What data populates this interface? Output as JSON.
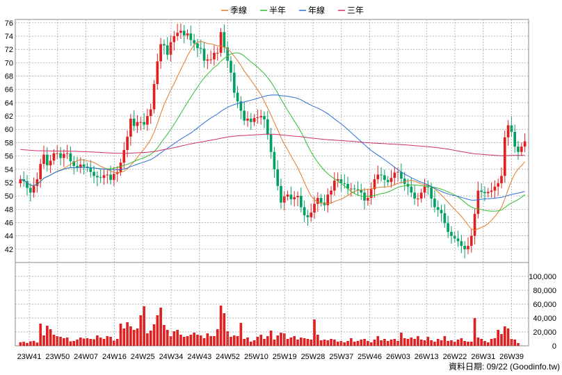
{
  "legend": [
    {
      "label": "季線",
      "color": "#e07b2a"
    },
    {
      "label": "半年",
      "color": "#2fbf2f"
    },
    {
      "label": "年線",
      "color": "#2d6fd6"
    },
    {
      "label": "三年",
      "color": "#d0306a"
    }
  ],
  "footer_note": "資料日期: 09/22 (Goodinfo.tw)",
  "colors": {
    "up": "#e02020",
    "down": "#00a060",
    "volume": "#e02020",
    "grid": "#999999"
  },
  "chart_data": [
    {
      "type": "candlestick",
      "title": "",
      "ylim": [
        40,
        76.5
      ],
      "y_ticks": [
        42,
        44,
        46,
        48,
        50,
        52,
        54,
        56,
        58,
        60,
        62,
        64,
        66,
        68,
        70,
        72,
        74,
        76
      ],
      "x_ticks": [
        "23W41",
        "23W50",
        "24W07",
        "24W16",
        "24W25",
        "24W34",
        "24W43",
        "24W52",
        "25W10",
        "25W19",
        "25W28",
        "25W37",
        "25W46",
        "26W03",
        "26W13",
        "26W22",
        "26W31",
        "26W39"
      ],
      "close": [
        52.5,
        52.2,
        51.2,
        50.5,
        51.5,
        52.5,
        54.8,
        56.2,
        54.6,
        55.3,
        56.4,
        56.4,
        55.7,
        56.3,
        56.4,
        55.2,
        54.5,
        54.3,
        54.7,
        54.4,
        54.2,
        53.6,
        53.0,
        52.8,
        52.7,
        53.1,
        53.2,
        52.4,
        53.3,
        53.6,
        55.0,
        56.9,
        58.9,
        61.6,
        60.5,
        61.1,
        61.1,
        60.7,
        62.0,
        63.0,
        66.8,
        70.2,
        72.8,
        72.6,
        71.2,
        73.1,
        74.0,
        74.5,
        74.8,
        74.1,
        74.4,
        73.4,
        72.9,
        72.2,
        72.1,
        70.3,
        70.5,
        70.5,
        71.5,
        71.5,
        74.6,
        72.3,
        70.3,
        68.5,
        65.5,
        64.2,
        62.8,
        61.3,
        61.6,
        61.1,
        61.7,
        61.8,
        62.0,
        61.5,
        59.2,
        56.6,
        54.0,
        51.5,
        49.0,
        49.9,
        50.2,
        49.5,
        49.8,
        50.0,
        48.3,
        47.1,
        46.8,
        47.5,
        48.8,
        49.7,
        49.0,
        48.6,
        50.2,
        50.8,
        52.3,
        52.5,
        51.9,
        51.8,
        51.1,
        51.1,
        51.0,
        50.9,
        50.5,
        49.3,
        49.7,
        51.0,
        52.5,
        53.2,
        53.1,
        52.4,
        52.1,
        52.7,
        53.5,
        53.6,
        52.6,
        51.8,
        51.4,
        50.5,
        49.6,
        49.6,
        50.5,
        51.4,
        51.3,
        49.6,
        48.3,
        47.9,
        47.4,
        45.9,
        44.6,
        44.0,
        43.6,
        43.2,
        42.5,
        42.0,
        42.5,
        44.0,
        47.3,
        50.8,
        50.6,
        50.4,
        50.6,
        50.8,
        51.4,
        51.9,
        53.0,
        58.8,
        60.6,
        59.6,
        57.4,
        56.6,
        57.4,
        58.2
      ],
      "volume": [
        5200,
        5800,
        4200,
        6500,
        7200,
        4800,
        32000,
        15000,
        29000,
        24000,
        16000,
        14000,
        13000,
        11000,
        12000,
        6500,
        7000,
        9000,
        12000,
        10500,
        11000,
        10000,
        9500,
        15000,
        12000,
        10000,
        14000,
        13000,
        7500,
        10000,
        32000,
        25000,
        34000,
        28000,
        23000,
        25000,
        44000,
        57000,
        18000,
        22000,
        31000,
        44000,
        55000,
        30000,
        23000,
        14000,
        21000,
        23000,
        16000,
        13000,
        14000,
        16000,
        19000,
        16000,
        15000,
        11000,
        18000,
        14000,
        14000,
        24000,
        58000,
        47000,
        21000,
        13000,
        15000,
        14000,
        33000,
        10000,
        12000,
        6000,
        8000,
        13000,
        16000,
        10000,
        14000,
        22000,
        9000,
        15000,
        19000,
        18000,
        10000,
        12000,
        14000,
        9000,
        12000,
        11000,
        10000,
        9000,
        38000,
        16000,
        8000,
        9000,
        8000,
        10000,
        9000,
        6000,
        7000,
        5000,
        7000,
        11000,
        6000,
        7000,
        9000,
        10000,
        7000,
        5000,
        9000,
        14000,
        8000,
        10000,
        7000,
        9000,
        10000,
        7000,
        19000,
        11000,
        10000,
        12000,
        10000,
        14000,
        9000,
        8000,
        13000,
        8000,
        6000,
        10000,
        8000,
        14000,
        7000,
        8000,
        6000,
        9000,
        11000,
        7000,
        6000,
        6000,
        40000,
        12000,
        10000,
        7000,
        5000,
        10000,
        11000,
        23000,
        17000,
        28000,
        25000,
        10000,
        9000,
        4000
      ],
      "volume_ylim": [
        0,
        120000
      ],
      "volume_ticks": [
        0,
        20000,
        40000,
        60000,
        80000,
        100000
      ],
      "volume_tick_labels": [
        "0",
        "20,000",
        "40,000",
        "60,000",
        "80,000",
        "100,000"
      ]
    }
  ]
}
